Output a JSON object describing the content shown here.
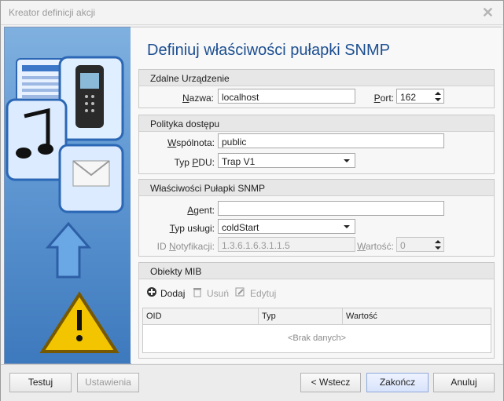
{
  "window": {
    "title": "Kreator definicji akcji",
    "close_icon": "close-icon"
  },
  "page": {
    "heading": "Definiuj właściwości pułapki SNMP"
  },
  "remote": {
    "title": "Zdalne Urządzenie",
    "name_label": "Nazwa:",
    "name_value": "localhost",
    "port_label": "Port:",
    "port_value": "162"
  },
  "policy": {
    "title": "Polityka dostępu",
    "community_label": "Wspólnota:",
    "community_value": "public",
    "pdu_label": "Typ PDU:",
    "pdu_value": "Trap V1"
  },
  "trap": {
    "title": "Właściwości Pułapki SNMP",
    "agent_label": "Agent:",
    "agent_value": "",
    "service_label": "Typ usługi:",
    "service_value": "coldStart",
    "notify_label": "ID Notyfikacji:",
    "notify_value": "1.3.6.1.6.3.1.1.5",
    "value_label": "Wartość:",
    "value_value": "0"
  },
  "mib": {
    "title": "Obiekty MIB",
    "add_label": "Dodaj",
    "remove_label": "Usuń",
    "edit_label": "Edytuj",
    "columns": [
      "OID",
      "Typ",
      "Wartość"
    ],
    "empty_text": "<Brak danych>"
  },
  "buttons": {
    "test": "Testuj",
    "settings": "Ustawienia",
    "back": "< Wstecz",
    "finish": "Zakończ",
    "cancel": "Anuluj"
  },
  "icons": {
    "sidebar": [
      "document-icon",
      "mobile-phone-icon",
      "music-note-icon",
      "mail-icon",
      "up-arrow-icon",
      "warning-icon"
    ],
    "toolbar": [
      "add-icon",
      "trash-icon",
      "edit-icon"
    ]
  },
  "colors": {
    "heading": "#1d4f91",
    "sidebar_blue": "#5f97d2",
    "warning": "#f2c500"
  }
}
